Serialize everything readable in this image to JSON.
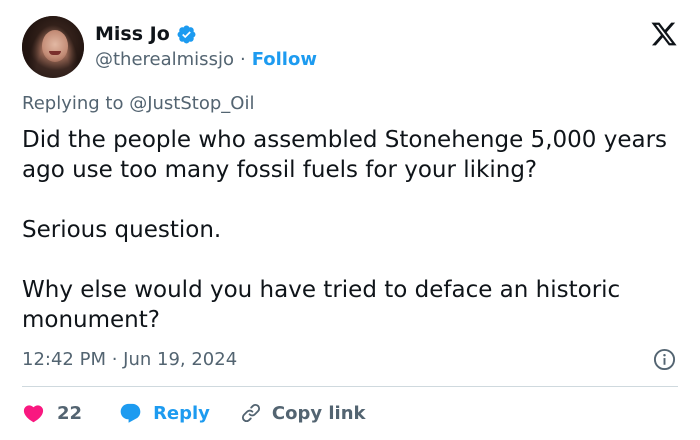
{
  "author": {
    "display_name": "Miss Jo",
    "handle": "@therealmissjo",
    "separator": "·",
    "follow_label": "Follow"
  },
  "reply_to": {
    "text": "Replying to @JustStop_Oil"
  },
  "tweet": {
    "paragraphs": [
      "Did the people who assembled Stonehenge 5,000 years ago use too many fossil fuels for your liking?",
      "Serious question.",
      "Why else would you have tried to deface an historic monument?"
    ],
    "timestamp": "12:42 PM · Jun 19, 2024"
  },
  "actions": {
    "like_count": "22",
    "reply_label": "Reply",
    "copy_link_label": "Copy link"
  },
  "colors": {
    "accent": "#1d9bf0",
    "heart": "#f91880",
    "secondary_text": "#536471",
    "primary_text": "#0f1419"
  },
  "icons": {
    "verified": "verified-badge-icon",
    "brand": "x-logo-icon",
    "info": "info-icon",
    "like": "heart-icon",
    "reply": "reply-bubble-icon",
    "copy": "link-icon"
  }
}
